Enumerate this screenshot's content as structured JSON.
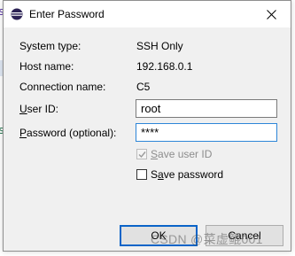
{
  "window": {
    "title": "Enter Password",
    "icon": "eclipse-icon",
    "close_icon": "close-icon"
  },
  "info": {
    "system_type_label": "System type:",
    "system_type_value": "SSH Only",
    "host_name_label": "Host name:",
    "host_name_value": "192.168.0.1",
    "connection_name_label": "Connection name:",
    "connection_name_value": "C5"
  },
  "form": {
    "user_id_label_pre": "",
    "user_id_label_ul": "U",
    "user_id_label_post": "ser ID:",
    "user_id_value": "root",
    "password_label_pre": "",
    "password_label_ul": "P",
    "password_label_post": "assword (optional):",
    "password_value": "****"
  },
  "options": {
    "save_user_id_pre": "",
    "save_user_id_ul": "S",
    "save_user_id_post": "ave user ID",
    "save_user_id_checked": true,
    "save_user_id_disabled": true,
    "save_password_pre": "S",
    "save_password_ul": "a",
    "save_password_post": "ve password",
    "save_password_checked": false
  },
  "buttons": {
    "ok_label": "OK",
    "cancel_label": "Cancel"
  },
  "watermark": "CSDN @菜虚鲲001",
  "colors": {
    "focus_border": "#2d86d8",
    "default_button_border": "#0a64c8",
    "dialog_bg": "#f0f0f0"
  }
}
